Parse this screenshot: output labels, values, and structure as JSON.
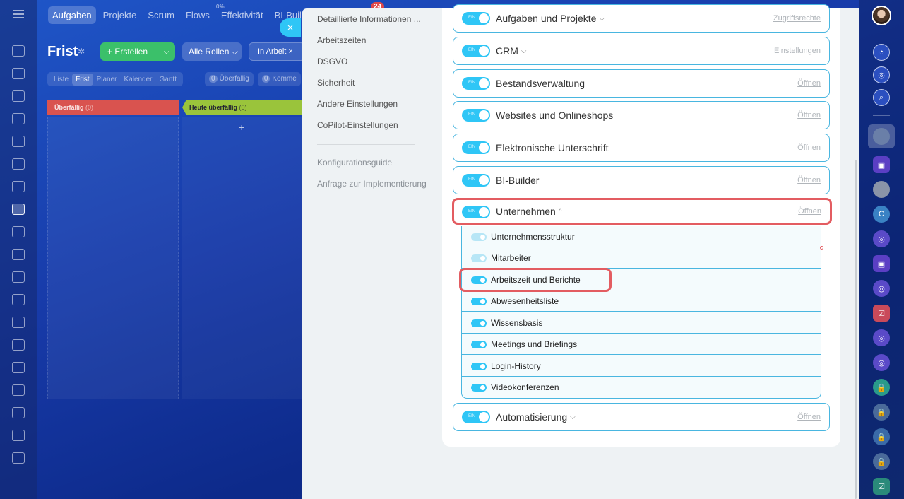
{
  "topnav": {
    "items": [
      "Aufgaben",
      "Projekte",
      "Scrum",
      "Flows",
      "Effektivität",
      "BI-Builder"
    ],
    "effektivitaet_pct": "0%",
    "badge": "24"
  },
  "board": {
    "title": "Frist",
    "create_label": "+ Erstellen",
    "roles_label": "Alle Rollen ⌵",
    "status_filter": "In Arbeit  ×",
    "view_tabs": [
      "Liste",
      "Frist",
      "Planer",
      "Kalender",
      "Gantt"
    ],
    "counter_overdue_num": "0",
    "counter_overdue_label": "Überfällig",
    "counter_comments_num": "0",
    "counter_comments_label": "Komme",
    "col1_title": "Überfällig",
    "col1_count": "(0)",
    "col2_title": "Heute überfällig",
    "col2_count": "(0)",
    "add_plus": "+"
  },
  "close_icon": "×",
  "nav": {
    "items": [
      "Detaillierte Informationen ...",
      "Arbeitszeiten",
      "DSGVO",
      "Sicherheit",
      "Andere Einstellungen",
      "CoPilot-Einstellungen"
    ],
    "secondary": [
      "Konfigurationsguide",
      "Anfrage zur Implementierung"
    ]
  },
  "toggle_text": "EIN",
  "modules": [
    {
      "title": "Aufgaben und Projekte",
      "chevron": "⌵",
      "link": "Zugriffsrechte"
    },
    {
      "title": "CRM",
      "chevron": "⌵",
      "link": "Einstellungen"
    },
    {
      "title": "Bestandsverwaltung",
      "chevron": "",
      "link": "Öffnen"
    },
    {
      "title": "Websites und Onlineshops",
      "chevron": "",
      "link": "Öffnen"
    },
    {
      "title": "Elektronische Unterschrift",
      "chevron": "",
      "link": "Öffnen"
    },
    {
      "title": "BI-Builder",
      "chevron": "",
      "link": "Öffnen"
    },
    {
      "title": "Unternehmen",
      "chevron": "^",
      "link": "Öffnen"
    },
    {
      "title": "Automatisierung",
      "chevron": "⌵",
      "link": "Öffnen"
    }
  ],
  "submodules": [
    {
      "label": "Unternehmensstruktur",
      "enabled": 0.5
    },
    {
      "label": "Mitarbeiter",
      "enabled": 0.5
    },
    {
      "label": "Arbeitszeit und Berichte",
      "enabled": 1
    },
    {
      "label": "Abwesenheitsliste",
      "enabled": 1
    },
    {
      "label": "Wissensbasis",
      "enabled": 1
    },
    {
      "label": "Meetings und Briefings",
      "enabled": 1
    },
    {
      "label": "Login-History",
      "enabled": 1
    },
    {
      "label": "Videokonferenzen",
      "enabled": 1
    }
  ],
  "colors": {
    "accent": "#2fc6f6",
    "highlight": "#e35c61",
    "row_border": "#49b6e0"
  }
}
